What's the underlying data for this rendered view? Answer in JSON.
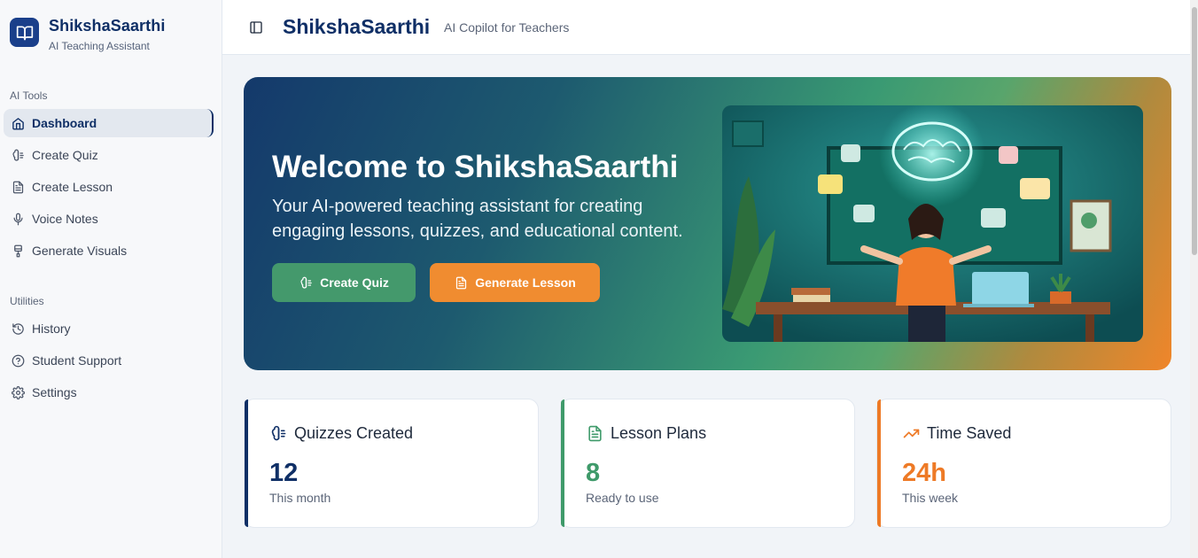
{
  "sidebar": {
    "brand_name": "ShikshaSaarthi",
    "brand_sub": "AI Teaching Assistant",
    "group_ai_tools": "AI Tools",
    "group_utilities": "Utilities",
    "items": [
      {
        "label": "Dashboard",
        "icon": "home-icon",
        "active": true
      },
      {
        "label": "Create Quiz",
        "icon": "brain-icon"
      },
      {
        "label": "Create Lesson",
        "icon": "document-icon"
      },
      {
        "label": "Voice Notes",
        "icon": "microphone-icon"
      },
      {
        "label": "Generate Visuals",
        "icon": "brush-icon"
      },
      {
        "label": "History",
        "icon": "history-icon"
      },
      {
        "label": "Student Support",
        "icon": "help-circle-icon"
      },
      {
        "label": "Settings",
        "icon": "gear-icon"
      }
    ]
  },
  "header": {
    "title": "ShikshaSaarthi",
    "subtitle": "AI Copilot for Teachers"
  },
  "hero": {
    "title": "Welcome to ShikshaSaarthi",
    "description": "Your AI-powered teaching assistant for creating engaging lessons, quizzes, and educational content.",
    "btn_quiz": "Create Quiz",
    "btn_lesson": "Generate Lesson"
  },
  "stats": [
    {
      "title": "Quizzes Created",
      "value": "12",
      "sub": "This month",
      "color": "#0f2f66",
      "icon": "brain-icon"
    },
    {
      "title": "Lesson Plans",
      "value": "8",
      "sub": "Ready to use",
      "color": "#3f9a6a",
      "icon": "document-icon"
    },
    {
      "title": "Time Saved",
      "value": "24h",
      "sub": "This week",
      "color": "#ee7a26",
      "icon": "trending-up-icon"
    }
  ],
  "colors": {
    "primary": "#0f2f66",
    "green": "#44996c",
    "orange": "#f08c30"
  }
}
